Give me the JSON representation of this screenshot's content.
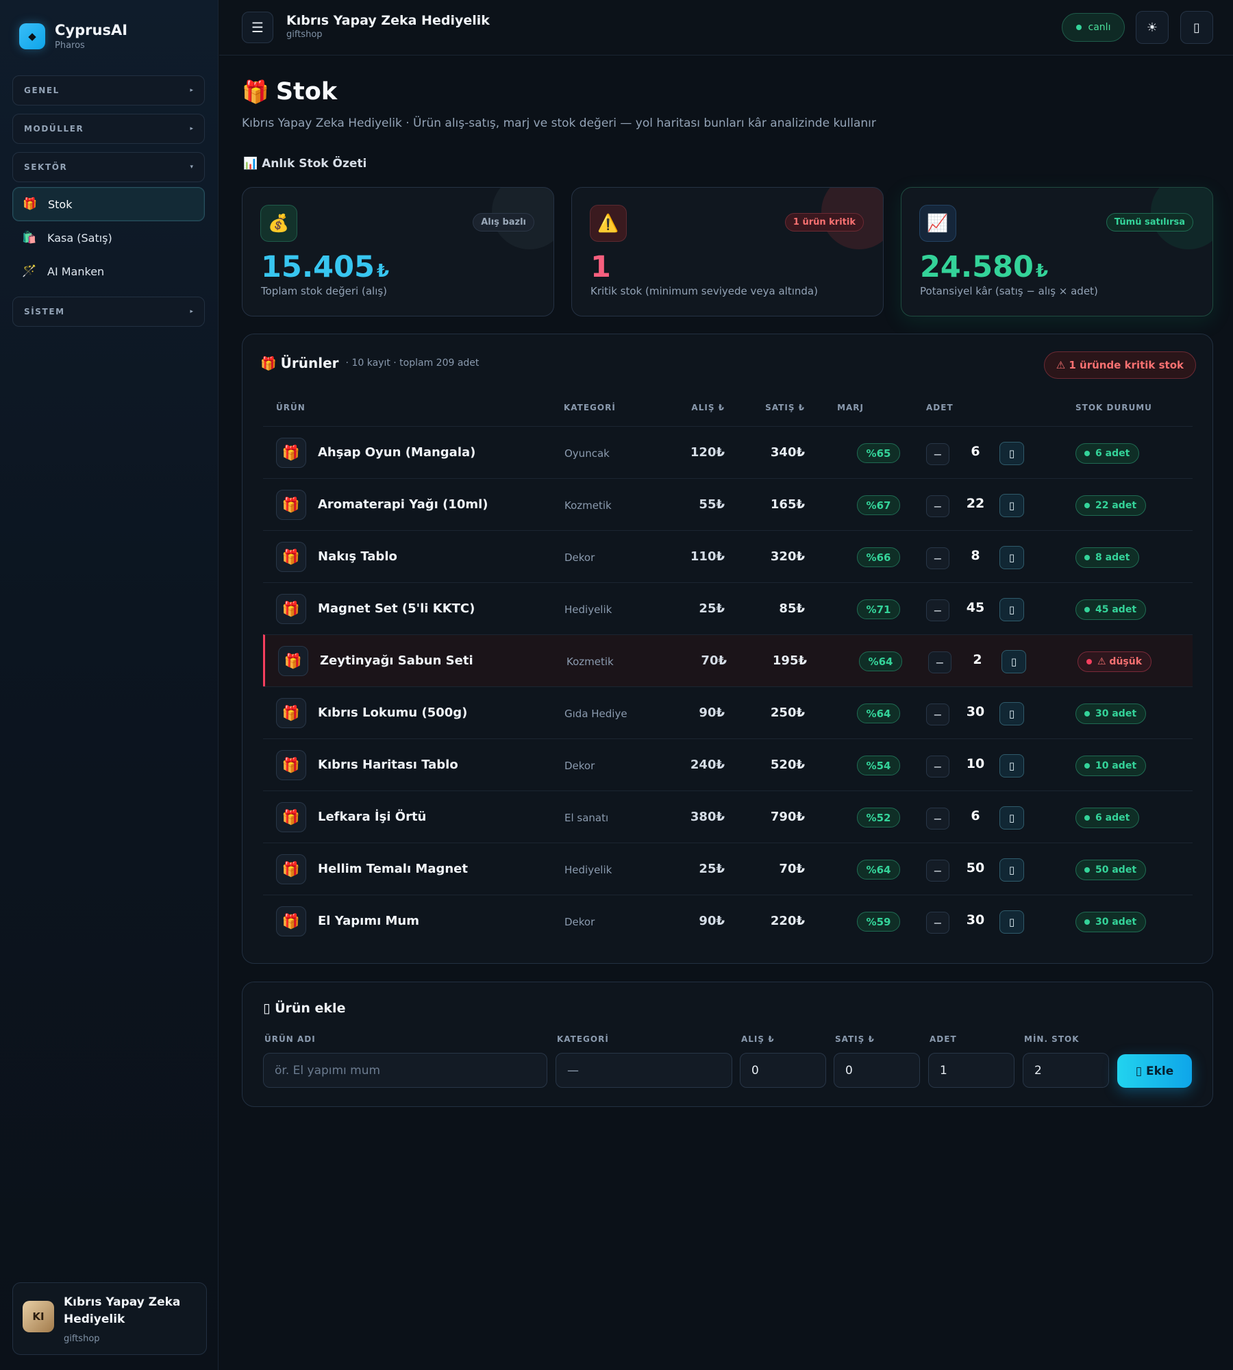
{
  "brand": {
    "name": "CyprusAI",
    "sub": "Pharos",
    "logo_icon": "◆"
  },
  "sidebar": {
    "groups": [
      {
        "label": "GENEL",
        "caret": "▸"
      },
      {
        "label": "MODÜLLER",
        "caret": "▸"
      },
      {
        "label": "SEKTÖR",
        "caret": "▾"
      },
      {
        "label": "SİSTEM",
        "caret": "▸"
      }
    ],
    "items": [
      {
        "icon": "🎁",
        "label": "Stok"
      },
      {
        "icon": "🛍️",
        "label": "Kasa (Satış)"
      },
      {
        "icon": "🪄",
        "label": "AI Manken"
      }
    ]
  },
  "account": {
    "initials": "KI",
    "name": "Kıbrıs Yapay Zeka Hediyelik",
    "sub": "giftshop"
  },
  "topbar": {
    "menu_icon": "☰",
    "title": "Kıbrıs Yapay Zeka Hediyelik",
    "sub": "giftshop",
    "live": "canlı",
    "theme_icon": "☀",
    "right_icon": "▯"
  },
  "page": {
    "icon": "🎁",
    "title": "Stok",
    "desc": "Kıbrıs Yapay Zeka Hediyelik · Ürün alış-satış, marj ve stok değeri — yol haritası bunları kâr analizinde kullanır"
  },
  "summary": {
    "label": "📊 Anlık Stok Özeti",
    "cards": [
      {
        "icon": "💰",
        "badge": "Alış bazlı",
        "value": "15.405",
        "currency": "₺",
        "caption": "Toplam stok değeri (alış)",
        "color": "#38c6f0"
      },
      {
        "icon": "⚠️",
        "badge": "1 ürün kritik",
        "value": "1",
        "currency": "",
        "caption": "Kritik stok (minimum seviyede veya altında)",
        "color": "#f75f7e"
      },
      {
        "icon": "📈",
        "badge": "Tümü satılırsa",
        "value": "24.580",
        "currency": "₺",
        "caption": "Potansiyel kâr (satış − alış × adet)",
        "color": "#34d399"
      }
    ]
  },
  "products": {
    "icon": "🎁",
    "title": "Ürünler",
    "meta": "· 10 kayıt · toplam 209 adet",
    "critical_pill": "⚠ 1 üründe kritik stok",
    "headers": {
      "product": "ÜRÜN",
      "category": "KATEGORİ",
      "buy": "ALIŞ ₺",
      "sell": "SATIŞ ₺",
      "margin": "MARJ",
      "qty": "ADET",
      "status": "STOK DURUMU"
    },
    "minus": "−",
    "plus": "▯",
    "rows": [
      {
        "icon": "🎁",
        "name": "Ahşap Oyun (Mangala)",
        "category": "Oyuncak",
        "buy": "120₺",
        "sell": "340₺",
        "margin": "%65",
        "qty": "6",
        "status": "6 adet",
        "low": false
      },
      {
        "icon": "🎁",
        "name": "Aromaterapi Yağı (10ml)",
        "category": "Kozmetik",
        "buy": "55₺",
        "sell": "165₺",
        "margin": "%67",
        "qty": "22",
        "status": "22 adet",
        "low": false
      },
      {
        "icon": "🎁",
        "name": "Nakış Tablo",
        "category": "Dekor",
        "buy": "110₺",
        "sell": "320₺",
        "margin": "%66",
        "qty": "8",
        "status": "8 adet",
        "low": false
      },
      {
        "icon": "🎁",
        "name": "Magnet Set (5'li KKTC)",
        "category": "Hediyelik",
        "buy": "25₺",
        "sell": "85₺",
        "margin": "%71",
        "qty": "45",
        "status": "45 adet",
        "low": false
      },
      {
        "icon": "🎁",
        "name": "Zeytinyağı Sabun Seti",
        "category": "Kozmetik",
        "buy": "70₺",
        "sell": "195₺",
        "margin": "%64",
        "qty": "2",
        "status": "⚠ düşük",
        "low": true
      },
      {
        "icon": "🎁",
        "name": "Kıbrıs Lokumu (500g)",
        "category": "Gıda Hediye",
        "buy": "90₺",
        "sell": "250₺",
        "margin": "%64",
        "qty": "30",
        "status": "30 adet",
        "low": false
      },
      {
        "icon": "🎁",
        "name": "Kıbrıs Haritası Tablo",
        "category": "Dekor",
        "buy": "240₺",
        "sell": "520₺",
        "margin": "%54",
        "qty": "10",
        "status": "10 adet",
        "low": false
      },
      {
        "icon": "🎁",
        "name": "Lefkara İşi Örtü",
        "category": "El sanatı",
        "buy": "380₺",
        "sell": "790₺",
        "margin": "%52",
        "qty": "6",
        "status": "6 adet",
        "low": false
      },
      {
        "icon": "🎁",
        "name": "Hellim Temalı Magnet",
        "category": "Hediyelik",
        "buy": "25₺",
        "sell": "70₺",
        "margin": "%64",
        "qty": "50",
        "status": "50 adet",
        "low": false
      },
      {
        "icon": "🎁",
        "name": "El Yapımı Mum",
        "category": "Dekor",
        "buy": "90₺",
        "sell": "220₺",
        "margin": "%59",
        "qty": "30",
        "status": "30 adet",
        "low": false
      }
    ]
  },
  "add_form": {
    "title": "▯ Ürün ekle",
    "labels": {
      "name": "ÜRÜN ADI",
      "category": "KATEGORİ",
      "buy": "ALIŞ ₺",
      "sell": "SATIŞ ₺",
      "qty": "ADET",
      "min": "MİN. STOK"
    },
    "name_placeholder": "ör. El yapımı mum",
    "category_value": "—",
    "buy_value": "0",
    "sell_value": "0",
    "qty_value": "1",
    "min_value": "2",
    "button": "▯ Ekle"
  }
}
